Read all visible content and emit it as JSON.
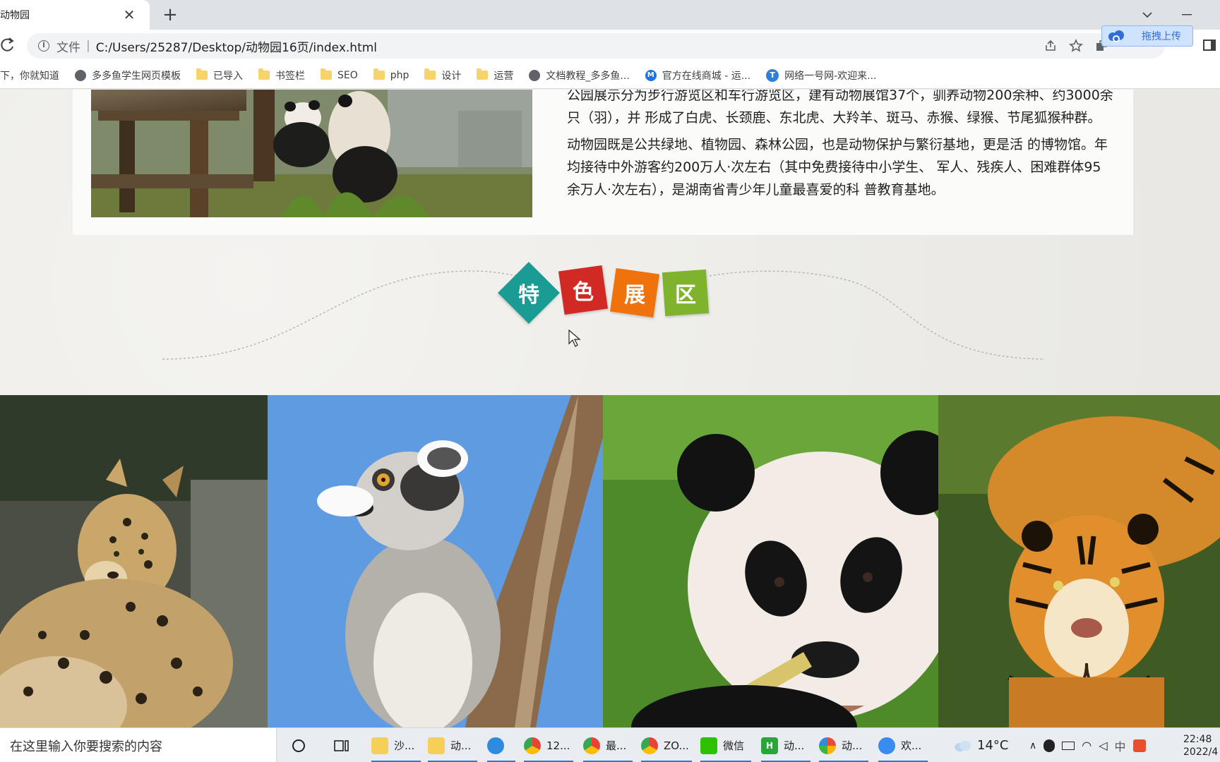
{
  "browser": {
    "tab_title": "动物园",
    "tab_close": "✕",
    "new_tab": "+",
    "scheme": "文件",
    "url": "C:/Users/25287/Desktop/动物园16页/index.html",
    "extension_upload": "拖拽上传"
  },
  "bookmarks": [
    {
      "label": "下，你就知道",
      "icon": "none"
    },
    {
      "label": "多多鱼学生网页模板",
      "icon": "globe"
    },
    {
      "label": "已导入",
      "icon": "folder"
    },
    {
      "label": "书签栏",
      "icon": "folder"
    },
    {
      "label": "SEO",
      "icon": "folder"
    },
    {
      "label": "php",
      "icon": "folder"
    },
    {
      "label": "设计",
      "icon": "folder"
    },
    {
      "label": "运营",
      "icon": "folder"
    },
    {
      "label": "文档教程_多多鱼...",
      "icon": "globe"
    },
    {
      "label": "官方在线商城 - 运...",
      "icon": "mi"
    },
    {
      "label": "网络一号网-欢迎来...",
      "icon": "wl"
    }
  ],
  "intro": {
    "paragraph_1": "公园展示分为步行游览区和车行游览区，建有动物展馆37个，驯养动物200余种、约3000余只（羽），并 形成了白虎、长颈鹿、东北虎、大羚羊、斑马、赤猴、绿猴、节尾狐猴种群。",
    "paragraph_2": "动物园既是公共绿地、植物园、森林公园，也是动物保护与繁衍基地，更是活 的博物馆。年均接待中外游客约200万人·次左右（其中免费接待中小学生、 军人、残疾人、困难群体95余万人·次左右），是湖南省青少年儿童最喜爱的科 普教育基地。"
  },
  "feature": {
    "tiles": [
      {
        "char": "特",
        "color": "#1a9b94"
      },
      {
        "char": "色",
        "color": "#d12a24"
      },
      {
        "char": "展",
        "color": "#f0720c"
      },
      {
        "char": "区",
        "color": "#7fb32d"
      }
    ]
  },
  "gallery": [
    {
      "name": "leopard"
    },
    {
      "name": "lemur"
    },
    {
      "name": "panda"
    },
    {
      "name": "tiger"
    }
  ],
  "taskbar": {
    "search_placeholder": "在这里输入你要搜索的内容",
    "apps": [
      {
        "label": "沙...",
        "icon": "folder"
      },
      {
        "label": "动...",
        "icon": "folder"
      },
      {
        "label": "",
        "icon": "edge"
      },
      {
        "label": "12...",
        "icon": "chrome"
      },
      {
        "label": "最...",
        "icon": "chrome"
      },
      {
        "label": "ZO...",
        "icon": "chrome"
      },
      {
        "label": "微信",
        "icon": "wechat"
      },
      {
        "label": "动...",
        "icon": "hbuilder"
      },
      {
        "label": "动...",
        "icon": "paint"
      },
      {
        "label": "欢...",
        "icon": "baidu"
      }
    ],
    "weather": "14°C",
    "ime": "中",
    "time": "22:48",
    "date": "2022/4"
  }
}
